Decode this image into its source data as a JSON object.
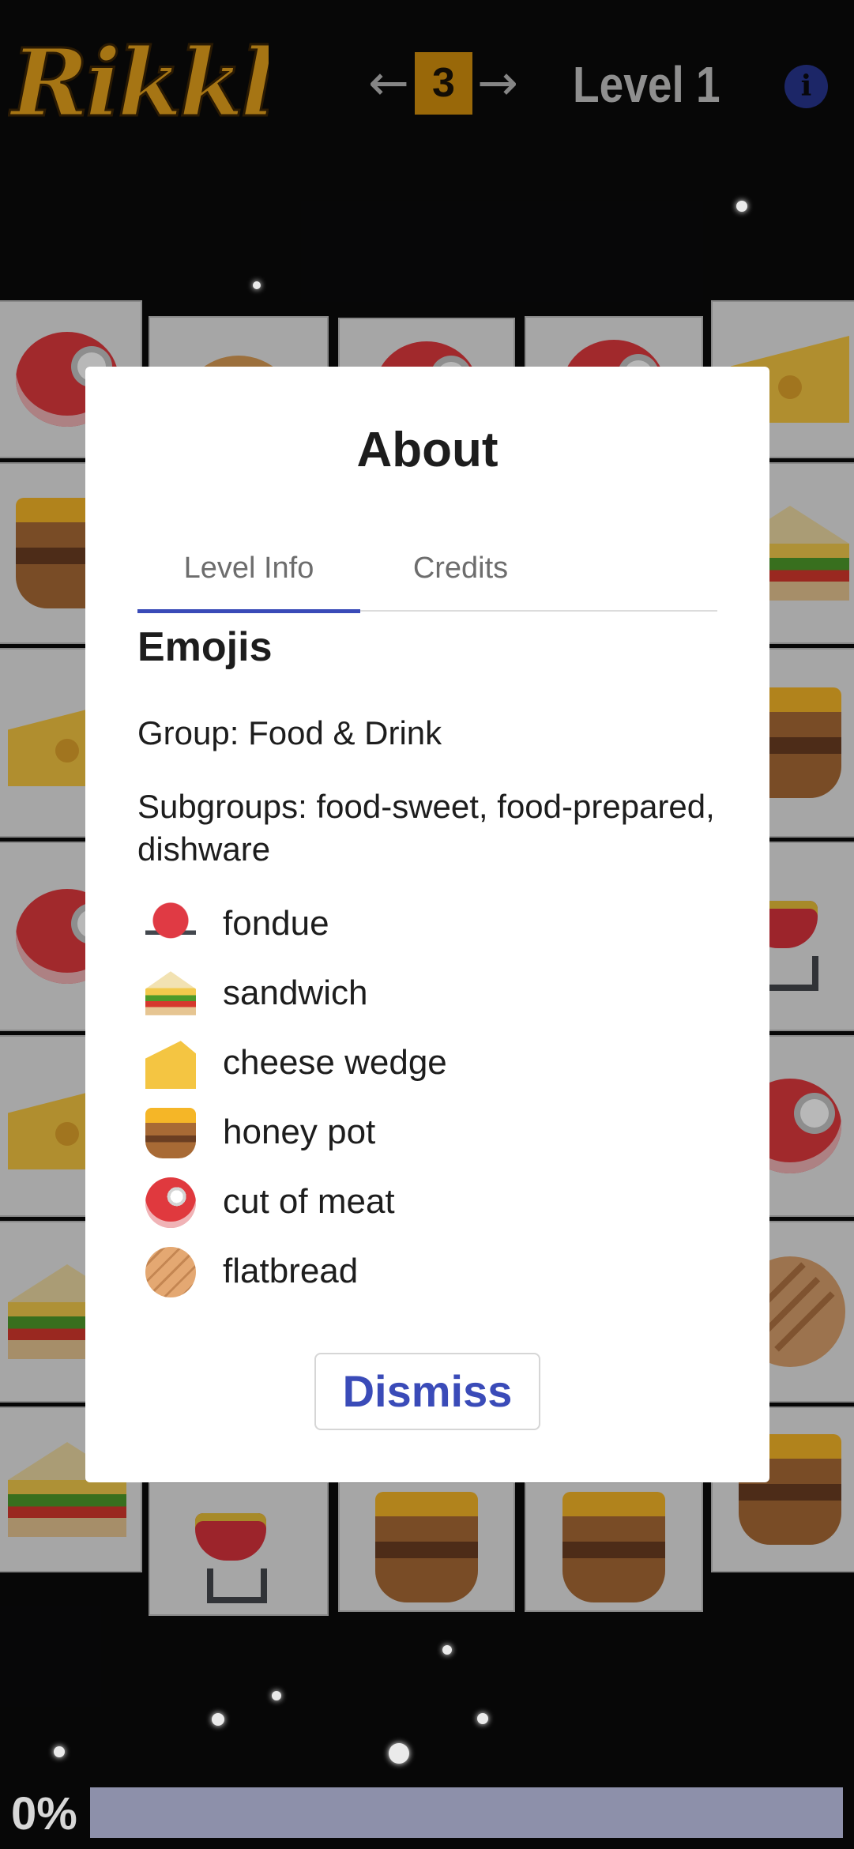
{
  "header": {
    "logo_text": "Rikkle",
    "prev_icon": "arrow-left-icon",
    "next_icon": "arrow-right-icon",
    "level_number": "3",
    "level_title": "Level 1",
    "info_icon": "info-icon"
  },
  "modal": {
    "title": "About",
    "tabs": [
      {
        "label": "Level Info",
        "active": true
      },
      {
        "label": "Credits",
        "active": false
      }
    ],
    "section_title": "Emojis",
    "group": "Group: Food & Drink",
    "subgroups": "Subgroups: food-sweet, food-prepared, dishware",
    "emojis": [
      {
        "icon": "fondue-icon",
        "label": "fondue"
      },
      {
        "icon": "sandwich-icon",
        "label": "sandwich"
      },
      {
        "icon": "cheese-wedge-icon",
        "label": "cheese wedge"
      },
      {
        "icon": "honey-pot-icon",
        "label": "honey pot"
      },
      {
        "icon": "cut-of-meat-icon",
        "label": "cut of meat"
      },
      {
        "icon": "flatbread-icon",
        "label": "flatbread"
      }
    ],
    "dismiss_label": "Dismiss"
  },
  "progress": {
    "label": "0%",
    "value": 0
  },
  "colors": {
    "accent": "#3a4bb8",
    "level_box": "#d4900d",
    "background": "#0a0a0b",
    "logo": "#e6a21c"
  }
}
